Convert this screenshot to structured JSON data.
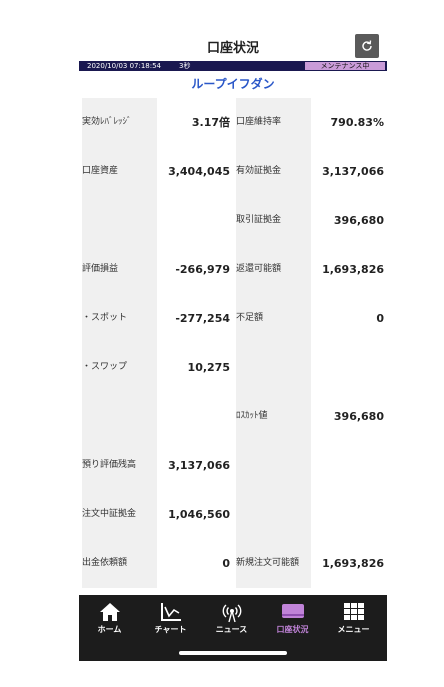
{
  "header": {
    "title": "口座状況"
  },
  "status": {
    "timestamp": "2020/10/03 07:18:54",
    "interval": "3秒",
    "maintenance": "メンテナンス中"
  },
  "account_name": "ループイフダン",
  "rows": [
    {
      "l_label": "実効ﾚﾊﾞﾚｯｼﾞ",
      "l_value": "3.17倍",
      "r_label": "口座維持率",
      "r_value": "790.83%"
    },
    {
      "l_label": "口座資産",
      "l_value": "3,404,045",
      "r_label": "有効証拠金",
      "r_value": "3,137,066"
    },
    {
      "l_label": "",
      "l_value": "",
      "r_label": "取引証拠金",
      "r_value": "396,680"
    },
    {
      "l_label": "評価損益",
      "l_value": "-266,979",
      "r_label": "返還可能額",
      "r_value": "1,693,826"
    },
    {
      "l_label": "・スポット",
      "l_value": "-277,254",
      "r_label": "不足額",
      "r_value": "0"
    },
    {
      "l_label": "・スワップ",
      "l_value": "10,275",
      "r_label": "",
      "r_value": ""
    },
    {
      "l_label": "",
      "l_value": "",
      "r_label": "ﾛｽｶｯﾄ値",
      "r_value": "396,680"
    },
    {
      "l_label": "預り評価残高",
      "l_value": "3,137,066",
      "r_label": "",
      "r_value": ""
    },
    {
      "l_label": "注文中証拠金",
      "l_value": "1,046,560",
      "r_label": "",
      "r_value": ""
    },
    {
      "l_label": "出金依頼額",
      "l_value": "0",
      "r_label": "新規注文可能額",
      "r_value": "1,693,826"
    }
  ],
  "nav": [
    {
      "label": "ホーム",
      "icon": "home-icon"
    },
    {
      "label": "チャート",
      "icon": "chart-icon"
    },
    {
      "label": "ニュース",
      "icon": "broadcast-icon"
    },
    {
      "label": "口座状況",
      "icon": "account-icon",
      "active": true
    },
    {
      "label": "メニュー",
      "icon": "menu-grid-icon"
    }
  ],
  "colors": {
    "accent": "#c083d8",
    "status_bg": "#1a1850",
    "account_name": "#2a57c8"
  }
}
